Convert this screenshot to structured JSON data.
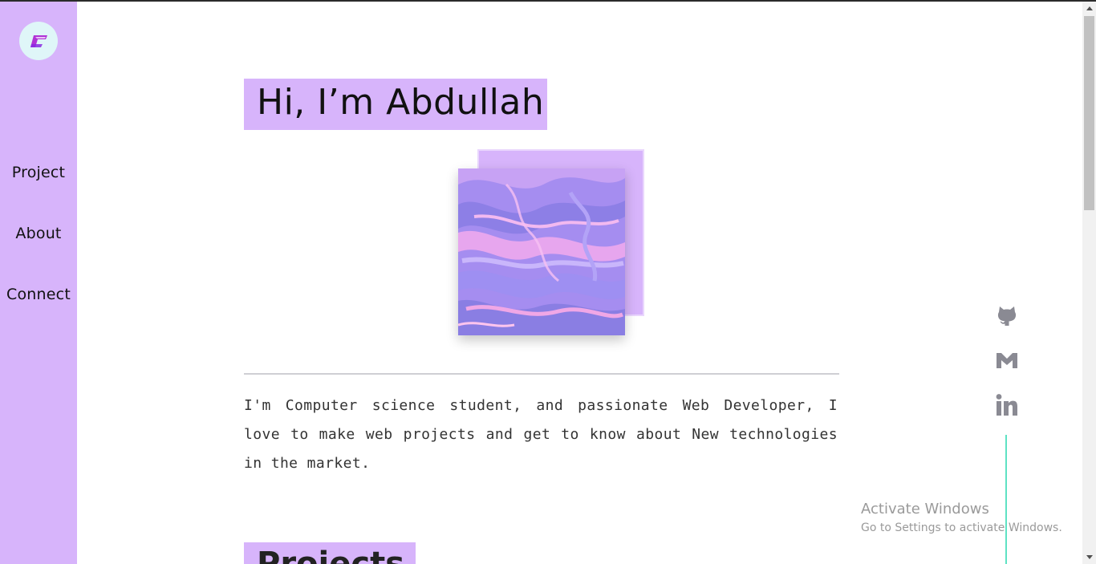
{
  "nav": {
    "items": [
      {
        "label": "Project"
      },
      {
        "label": "About"
      },
      {
        "label": "Connect"
      }
    ]
  },
  "hero": {
    "title": "Hi, I’m Abdullah"
  },
  "bio": {
    "text": "I'm Computer science student, and passionate Web Developer, I love to make web projects and get to know about New technologies in the market."
  },
  "projects_section": {
    "title": "Projects"
  },
  "social": [
    {
      "icon": "github-icon"
    },
    {
      "icon": "gmail-icon"
    },
    {
      "icon": "linkedin-icon"
    }
  ],
  "watermark": {
    "title": "Activate Windows",
    "subtitle": "Go to Settings to activate Windows."
  },
  "colors": {
    "accent": "#d7b4fb",
    "rail": "#5ee2c4",
    "icon": "#8a8a93"
  }
}
